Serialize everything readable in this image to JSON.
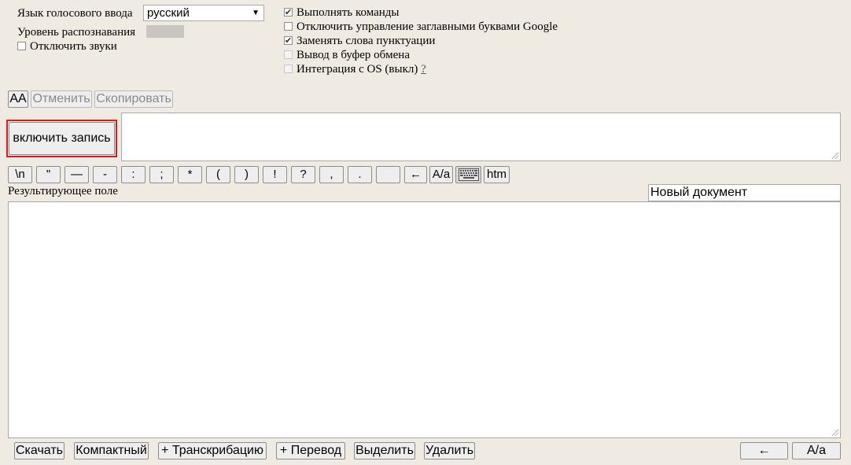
{
  "settings": {
    "lang_label": "Язык голосового ввода",
    "lang_value": "русский",
    "level_label": "Уровень распознавания",
    "mute_label": "Отключить звуки",
    "options": [
      {
        "label": "Выполнять команды",
        "checked": true,
        "disabled": false
      },
      {
        "label": "Отключить управление заглавными буквами Google",
        "checked": false,
        "disabled": false
      },
      {
        "label": "Заменять слова пунктуации",
        "checked": true,
        "disabled": false
      },
      {
        "label": "Вывод в буфер обмена",
        "checked": false,
        "disabled": true
      },
      {
        "label": "Интеграция с OS (выкл)",
        "checked": false,
        "disabled": true
      }
    ],
    "help_link": "?"
  },
  "toolbar": {
    "aa_label": "AA",
    "undo_label": "Отменить",
    "copy_label": "Скопировать"
  },
  "record_button": "включить запись",
  "punctuation": [
    "\\n",
    "\"",
    "—",
    "-",
    ":",
    ";",
    "*",
    "(",
    ")",
    "!",
    "?",
    ",",
    ".",
    " ",
    "←",
    "A/a",
    "",
    "htm"
  ],
  "result": {
    "label": "Результирующее поле",
    "doc_name": "Новый документ"
  },
  "bottom_buttons": {
    "download": "Скачать",
    "compact": "Компактный",
    "transcription": "+ Транскрибацию",
    "translate": "+ Перевод",
    "select": "Выделить",
    "delete": "Удалить",
    "backspace": "←",
    "case": "A/a"
  }
}
